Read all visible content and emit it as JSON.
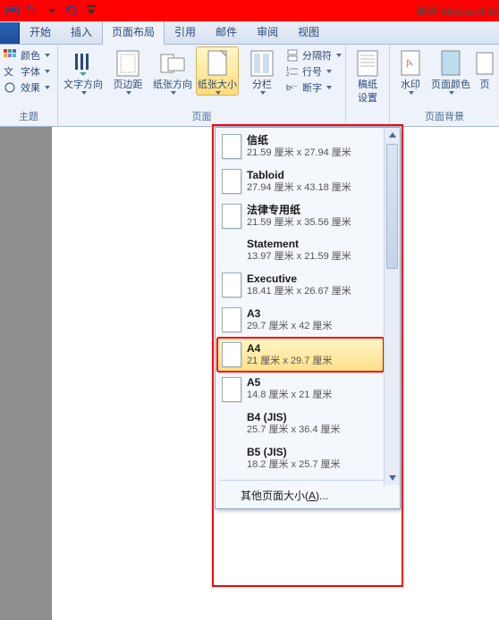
{
  "titlebar": {
    "title": "新建 Microsoft W"
  },
  "tabs": {
    "start": "开始",
    "insert": "插入",
    "layout": "页面布局",
    "ref": "引用",
    "mail": "邮件",
    "review": "审阅",
    "view": "视图"
  },
  "ribbon": {
    "theme_group": {
      "colors": "颜色",
      "fonts": "字体",
      "effects": "效果",
      "label": "主题"
    },
    "page_setup": {
      "text_dir": "文字方向",
      "margins": "页边距",
      "orientation": "纸张方向",
      "size": "纸张大小",
      "columns": "分栏",
      "breaks": "分隔符",
      "line_no": "行号",
      "hyphen": "断字",
      "label": "页面"
    },
    "paper": {
      "setting": "稿纸",
      "setting2": "设置"
    },
    "bg": {
      "watermark": "水印",
      "page_color": "页面颜色",
      "border": "页",
      "label": "页面背景"
    }
  },
  "paper_sizes": [
    {
      "name": "信纸",
      "dim": "21.59 厘米 x 27.94 厘米",
      "ico": "p"
    },
    {
      "name": "Tabloid",
      "dim": "27.94 厘米 x 43.18 厘米",
      "ico": "p"
    },
    {
      "name": "法律专用纸",
      "dim": "21.59 厘米 x 35.56 厘米",
      "ico": "p"
    },
    {
      "name": "Statement",
      "dim": "13.97 厘米 x 21.59 厘米",
      "ico": ""
    },
    {
      "name": "Executive",
      "dim": "18.41 厘米 x 26.67 厘米",
      "ico": "p"
    },
    {
      "name": "A3",
      "dim": "29.7 厘米 x 42 厘米",
      "ico": "p"
    },
    {
      "name": "A4",
      "dim": "21 厘米 x 29.7 厘米",
      "ico": "p",
      "selected": true
    },
    {
      "name": "A5",
      "dim": "14.8 厘米 x 21 厘米",
      "ico": "p"
    },
    {
      "name": "B4 (JIS)",
      "dim": "25.7 厘米 x 36.4 厘米",
      "ico": ""
    },
    {
      "name": "B5 (JIS)",
      "dim": "18.2 厘米 x 25.7 厘米",
      "ico": ""
    }
  ],
  "more_sizes": {
    "pre": "其他页面大小(",
    "key": "A",
    "post": ")..."
  }
}
